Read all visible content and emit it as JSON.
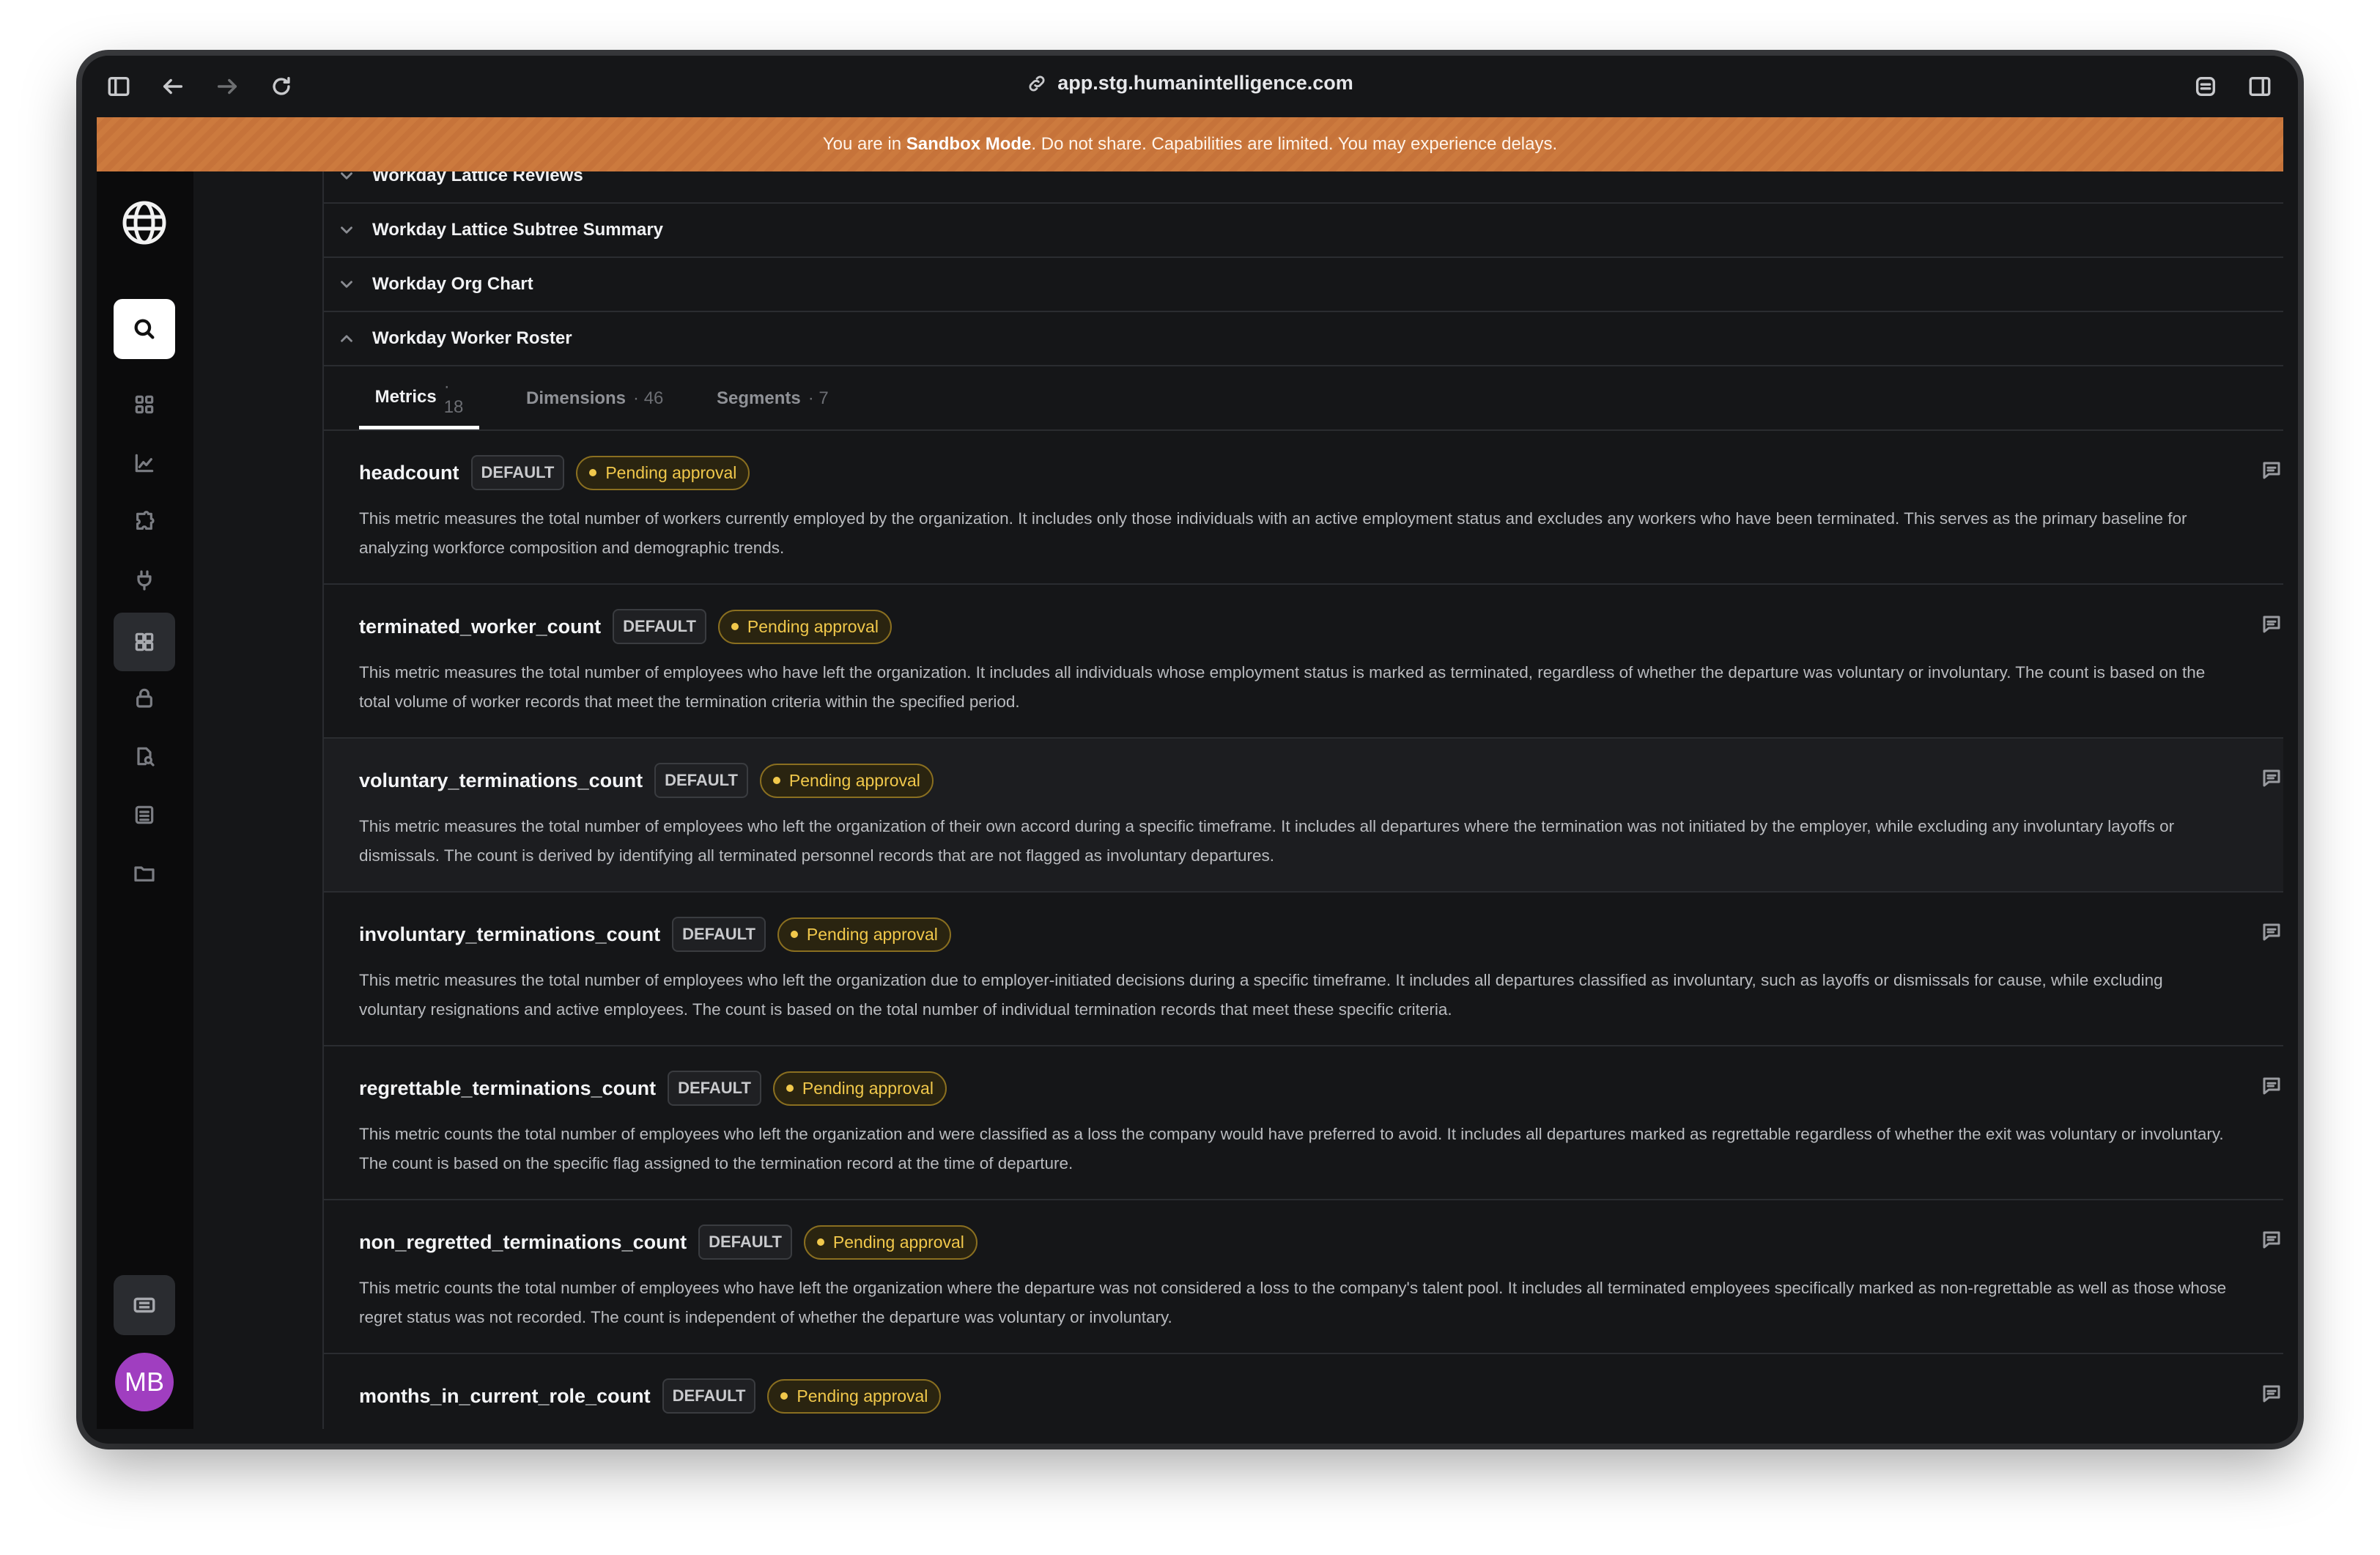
{
  "browser": {
    "url": "app.stg.humanintelligence.com"
  },
  "banner": {
    "prefix": "You are in ",
    "mode": "Sandbox Mode",
    "suffix": ". Do not share. Capabilities are limited. You may experience delays."
  },
  "sidebar": {
    "avatar_initials": "MB",
    "icons": [
      "grid-icon",
      "chart-icon",
      "puzzle-icon",
      "plug-icon",
      "dashboard-icon",
      "lock-icon",
      "document-search-icon",
      "list-icon",
      "folder-icon"
    ]
  },
  "accordion": [
    {
      "label": "Workday Lattice Reviews",
      "expanded": false
    },
    {
      "label": "Workday Lattice Subtree Summary",
      "expanded": false
    },
    {
      "label": "Workday Org Chart",
      "expanded": false
    },
    {
      "label": "Workday Worker Roster",
      "expanded": true
    }
  ],
  "tabs": [
    {
      "label": "Metrics",
      "count": "· 18",
      "active": true
    },
    {
      "label": "Dimensions",
      "count": "· 46",
      "active": false
    },
    {
      "label": "Segments",
      "count": "· 7",
      "active": false
    }
  ],
  "metrics": [
    {
      "name": "headcount",
      "tag": "DEFAULT",
      "status": "Pending approval",
      "description": "This metric measures the total number of workers currently employed by the organization. It includes only those individuals with an active employment status and excludes any workers who have been terminated. This serves as the primary baseline for analyzing workforce composition and demographic trends."
    },
    {
      "name": "terminated_worker_count",
      "tag": "DEFAULT",
      "status": "Pending approval",
      "description": "This metric measures the total number of employees who have left the organization. It includes all individuals whose employment status is marked as terminated, regardless of whether the departure was voluntary or involuntary. The count is based on the total volume of worker records that meet the termination criteria within the specified period."
    },
    {
      "name": "voluntary_terminations_count",
      "tag": "DEFAULT",
      "status": "Pending approval",
      "description": "This metric measures the total number of employees who left the organization of their own accord during a specific timeframe. It includes all departures where the termination was not initiated by the employer, while excluding any involuntary layoffs or dismissals. The count is derived by identifying all terminated personnel records that are not flagged as involuntary departures."
    },
    {
      "name": "involuntary_terminations_count",
      "tag": "DEFAULT",
      "status": "Pending approval",
      "description": "This metric measures the total number of employees who left the organization due to employer-initiated decisions during a specific timeframe. It includes all departures classified as involuntary, such as layoffs or dismissals for cause, while excluding voluntary resignations and active employees. The count is based on the total number of individual termination records that meet these specific criteria."
    },
    {
      "name": "regrettable_terminations_count",
      "tag": "DEFAULT",
      "status": "Pending approval",
      "description": "This metric counts the total number of employees who left the organization and were classified as a loss the company would have preferred to avoid. It includes all departures marked as regrettable regardless of whether the exit was voluntary or involuntary. The count is based on the specific flag assigned to the termination record at the time of departure."
    },
    {
      "name": "non_regretted_terminations_count",
      "tag": "DEFAULT",
      "status": "Pending approval",
      "description": "This metric counts the total number of employees who have left the organization where the departure was not considered a loss to the company's talent pool. It includes all terminated employees specifically marked as non-regrettable as well as those whose regret status was not recorded. The count is independent of whether the departure was voluntary or involuntary."
    },
    {
      "name": "months_in_current_role_count",
      "tag": "DEFAULT",
      "status": "Pending approval",
      "description": ""
    }
  ]
}
